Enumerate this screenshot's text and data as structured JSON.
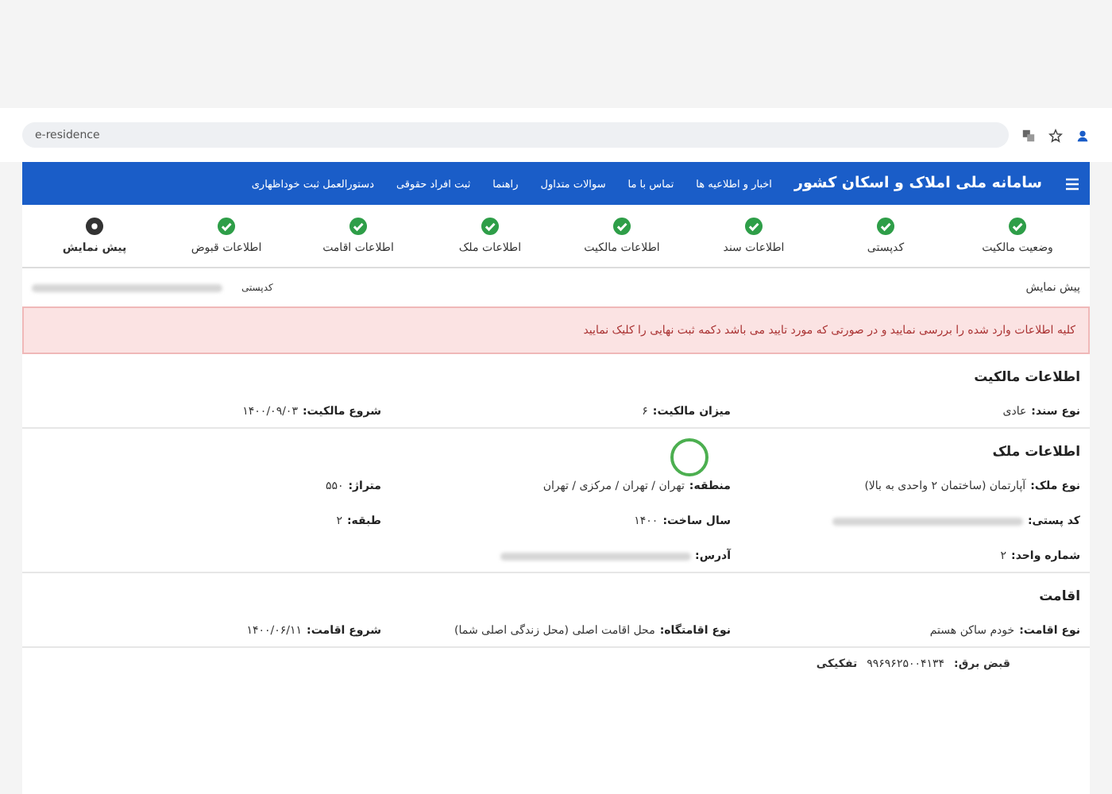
{
  "browser": {
    "url": "e-residence"
  },
  "header": {
    "title": "سامانه ملی املاک و اسکان کشور",
    "links": [
      "اخبار و اطلاعیه ها",
      "تماس با ما",
      "سوالات متداول",
      "راهنما",
      "ثبت افراد حقوقی",
      "دستورالعمل ثبت خوداظهاری"
    ]
  },
  "steps": [
    {
      "label": "وضعیت مالکیت",
      "done": true
    },
    {
      "label": "کدپستی",
      "done": true
    },
    {
      "label": "اطلاعات سند",
      "done": true
    },
    {
      "label": "اطلاعات مالکیت",
      "done": true
    },
    {
      "label": "اطلاعات ملک",
      "done": true
    },
    {
      "label": "اطلاعات اقامت",
      "done": true
    },
    {
      "label": "اطلاعات قبوض",
      "done": true
    },
    {
      "label": "پیش نمایش",
      "done": false
    }
  ],
  "preview": {
    "title": "پیش نمایش",
    "postal_label": "کدپستی"
  },
  "alert": "کلیه اطلاعات وارد شده را بررسی نمایید و در صورتی که مورد تایید می باشد دکمه ثبت نهایی را کلیک نمایید",
  "sections": [
    {
      "title": "اطلاعات مالکیت",
      "fields": [
        {
          "label": "نوع سند:",
          "value": "عادی",
          "redacted": false
        },
        {
          "label": "میزان مالکیت:",
          "value": "۶",
          "redacted": false
        },
        {
          "label": "شروع مالکیت:",
          "value": "۱۴۰۰/۰۹/۰۳",
          "redacted": false
        }
      ]
    },
    {
      "title": "اطلاعات ملک",
      "fields": [
        {
          "label": "نوع ملک:",
          "value": "آپارتمان (ساختمان ۲ واحدی به بالا)",
          "redacted": false
        },
        {
          "label": "منطقه:",
          "value": "تهران / تهران / مرکزی / تهران",
          "redacted": false
        },
        {
          "label": "متراژ:",
          "value": "۵۵۰",
          "redacted": false
        },
        {
          "label": "کد پستی:",
          "redacted": true
        },
        {
          "label": "سال ساخت:",
          "value": "۱۴۰۰",
          "redacted": false
        },
        {
          "label": "طبقه:",
          "value": "۲",
          "redacted": false
        },
        {
          "label": "شماره واحد:",
          "value": "۲",
          "redacted": false
        },
        {
          "label": "آدرس:",
          "redacted": true
        }
      ]
    },
    {
      "title": "اقامت",
      "fields": [
        {
          "label": "نوع اقامت:",
          "value": "خودم ساکن هستم",
          "redacted": false
        },
        {
          "label": "نوع اقامتگاه:",
          "value": "محل اقامت اصلی (محل زندگی اصلی شما)",
          "redacted": false
        },
        {
          "label": "شروع اقامت:",
          "value": "۱۴۰۰/۰۶/۱۱",
          "redacted": false
        }
      ]
    }
  ],
  "bill": {
    "label": "قبض برق:",
    "value": "۹۹۶۹۶۲۵۰۰۴۱۳۴",
    "tag": "تفکیکی"
  }
}
